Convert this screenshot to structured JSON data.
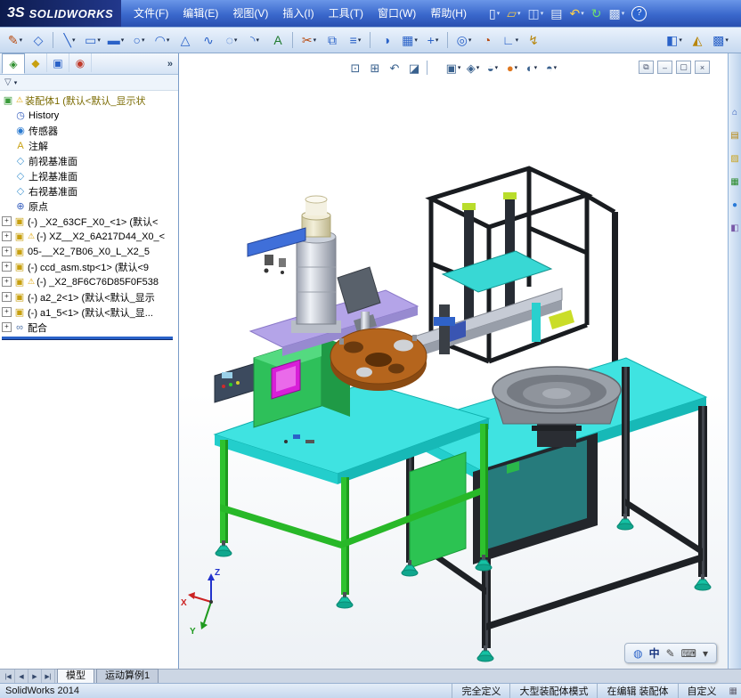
{
  "ui": {
    "caret": "▾",
    "warn_glyph": "⚠",
    "plus_glyph": "+",
    "chevrons": "»"
  },
  "titlebar": {
    "logo_mark": "3S",
    "logo_text": "SOLIDWORKS",
    "menus": [
      {
        "name": "menu-file",
        "label": "文件(F)"
      },
      {
        "name": "menu-edit",
        "label": "编辑(E)"
      },
      {
        "name": "menu-view",
        "label": "视图(V)"
      },
      {
        "name": "menu-insert",
        "label": "插入(I)"
      },
      {
        "name": "menu-tools",
        "label": "工具(T)"
      },
      {
        "name": "menu-window",
        "label": "窗口(W)"
      },
      {
        "name": "menu-help",
        "label": "帮助(H)"
      }
    ],
    "tools": [
      {
        "name": "new-button",
        "glyph": "▯",
        "color": "#f4f8ff",
        "caret": true
      },
      {
        "name": "open-button",
        "glyph": "▱",
        "color": "#f2c84b",
        "caret": true
      },
      {
        "name": "save-button",
        "glyph": "◫",
        "color": "#cfe0ff",
        "caret": true
      },
      {
        "name": "print-button",
        "glyph": "▤",
        "color": "#e4ecf8"
      },
      {
        "name": "undo-button",
        "glyph": "↶",
        "color": "#ffd24a",
        "caret": true
      },
      {
        "name": "rebuild-button",
        "glyph": "↻",
        "color": "#6fe06f"
      },
      {
        "name": "options-button",
        "glyph": "▩",
        "color": "#dde6f4",
        "caret": true
      },
      {
        "name": "help-button",
        "glyph": "?",
        "color": "#ffffff"
      }
    ]
  },
  "toolbar2": {
    "buttons": [
      {
        "name": "sketch-button",
        "glyph": "✎",
        "color": "#b84a10",
        "caret": true
      },
      {
        "name": "smart-dimension-button",
        "glyph": "◇",
        "color": "#2a62c8"
      },
      {
        "name": "separator"
      },
      {
        "name": "line-tool-button",
        "glyph": "╲",
        "color": "#2a62c8",
        "caret": true
      },
      {
        "name": "rectangle-tool-button",
        "glyph": "▭",
        "color": "#2a62c8",
        "caret": true
      },
      {
        "name": "slot-tool-button",
        "glyph": "▬",
        "color": "#2a62c8",
        "caret": true
      },
      {
        "name": "circle-tool-button",
        "glyph": "○",
        "color": "#2a62c8",
        "caret": true
      },
      {
        "name": "arc-tool-button",
        "glyph": "◠",
        "color": "#2a62c8",
        "caret": true
      },
      {
        "name": "polygon-tool-button",
        "glyph": "△",
        "color": "#2a62c8"
      },
      {
        "name": "spline-tool-button",
        "glyph": "∿",
        "color": "#2a62c8"
      },
      {
        "name": "ellipse-tool-button",
        "glyph": "◌",
        "color": "#2a62c8",
        "caret": true
      },
      {
        "name": "fillet-tool-button",
        "glyph": "◝",
        "color": "#2a62c8",
        "caret": true
      },
      {
        "name": "text-tool-button",
        "glyph": "A",
        "color": "#1f7a2f"
      },
      {
        "name": "separator"
      },
      {
        "name": "trim-entities-button",
        "glyph": "✂",
        "color": "#b84a10",
        "caret": true
      },
      {
        "name": "convert-entities-button",
        "glyph": "⧉",
        "color": "#2a62c8"
      },
      {
        "name": "offset-entities-button",
        "glyph": "≡",
        "color": "#2a62c8",
        "caret": true
      },
      {
        "name": "separator"
      },
      {
        "name": "mirror-entities-button",
        "glyph": "◑",
        "color": "#2a62c8"
      },
      {
        "name": "linear-pattern-button",
        "glyph": "▦",
        "color": "#2a62c8",
        "caret": true
      },
      {
        "name": "move-entities-button",
        "glyph": "+",
        "color": "#2a62c8",
        "caret": true
      },
      {
        "name": "separator"
      },
      {
        "name": "display-relations-button",
        "glyph": "◎",
        "color": "#2a62c8",
        "caret": true
      },
      {
        "name": "repair-sketch-button",
        "glyph": "◔",
        "color": "#b84a10"
      },
      {
        "name": "quick-snaps-button",
        "glyph": "∟",
        "color": "#2a62c8",
        "caret": true
      },
      {
        "name": "rapid-sketch-button",
        "glyph": "↯",
        "color": "#b8860b"
      }
    ],
    "right_buttons": [
      {
        "name": "selection-filter-button",
        "glyph": "◧",
        "color": "#2a62c8",
        "caret": true
      },
      {
        "name": "instant3d-button",
        "glyph": "◭",
        "color": "#b8860b"
      },
      {
        "name": "view-settings-dropdown-button",
        "glyph": "▩",
        "color": "#2a62c8",
        "caret": true
      }
    ]
  },
  "panel": {
    "tabs": [
      {
        "name": "featuremanager-tab",
        "glyph": "◈",
        "color": "#2f8f2f"
      },
      {
        "name": "propertymanager-tab",
        "glyph": "◆",
        "color": "#c8a010"
      },
      {
        "name": "configurationmanager-tab",
        "glyph": "▣",
        "color": "#2a62c8"
      },
      {
        "name": "displaymanager-tab",
        "glyph": "◉",
        "color": "#c03a2a"
      }
    ],
    "filter_glyph": "▽",
    "tree_items": [
      {
        "name": "tree-root-assembly",
        "pad": "2px",
        "icon": "▣",
        "iconName": "assembly-icon",
        "iconColor": "#3a9b3a",
        "warn": true,
        "label": "装配体1 (默认<默认_显示状",
        "labelColor": "#7a6a00"
      },
      {
        "name": "tree-item-history",
        "pad": "16px",
        "icon": "◷",
        "iconName": "history-icon",
        "iconColor": "#3a62c0",
        "label": "History"
      },
      {
        "name": "tree-item-sensors",
        "pad": "16px",
        "icon": "◉",
        "iconName": "sensors-icon",
        "iconColor": "#2a7ad0",
        "label": "传感器"
      },
      {
        "name": "tree-item-annotations",
        "pad": "16px",
        "icon": "A",
        "iconName": "annotations-icon",
        "iconColor": "#c8a010",
        "label": "注解"
      },
      {
        "name": "tree-item-front-plane",
        "pad": "16px",
        "icon": "◇",
        "iconName": "plane-icon",
        "iconColor": "#4a9ad4",
        "label": "前视基准面"
      },
      {
        "name": "tree-item-top-plane",
        "pad": "16px",
        "icon": "◇",
        "iconName": "plane-icon",
        "iconColor": "#4a9ad4",
        "label": "上视基准面"
      },
      {
        "name": "tree-item-right-plane",
        "pad": "16px",
        "icon": "◇",
        "iconName": "plane-icon",
        "iconColor": "#4a9ad4",
        "label": "右视基准面"
      },
      {
        "name": "tree-item-origin",
        "pad": "16px",
        "icon": "⊕",
        "iconName": "origin-icon",
        "iconColor": "#3a62c0",
        "label": "原点"
      },
      {
        "name": "tree-item-component-1",
        "pad": "2px",
        "plus": true,
        "icon": "▣",
        "iconName": "component-icon",
        "iconColor": "#c8a010",
        "label": "(-) _X2_63CF_X0_<1> (默认<"
      },
      {
        "name": "tree-item-component-2",
        "pad": "2px",
        "plus": true,
        "icon": "▣",
        "iconName": "component-icon",
        "iconColor": "#c8a010",
        "warn": true,
        "label": "(-) XZ__X2_6A217D44_X0_<"
      },
      {
        "name": "tree-item-component-3",
        "pad": "2px",
        "plus": true,
        "icon": "▣",
        "iconName": "component-icon",
        "iconColor": "#c8a010",
        "label": "05-__X2_7B06_X0_L_X2_5"
      },
      {
        "name": "tree-item-component-4",
        "pad": "2px",
        "plus": true,
        "icon": "▣",
        "iconName": "component-icon",
        "iconColor": "#c8a010",
        "label": "(-) ccd_asm.stp<1> (默认<9"
      },
      {
        "name": "tree-item-component-5",
        "pad": "2px",
        "plus": true,
        "icon": "▣",
        "iconName": "component-icon",
        "iconColor": "#c8a010",
        "warn": true,
        "label": "(-) _X2_8F6C76D85F0F538"
      },
      {
        "name": "tree-item-component-6",
        "pad": "2px",
        "plus": true,
        "icon": "▣",
        "iconName": "component-icon",
        "iconColor": "#c8a010",
        "label": "(-) a2_2<1> (默认<默认_显示"
      },
      {
        "name": "tree-item-component-7",
        "pad": "2px",
        "plus": true,
        "icon": "▣",
        "iconName": "component-icon",
        "iconColor": "#c8a010",
        "label": "(-) a1_5<1> (默认<默认_显..."
      },
      {
        "name": "tree-item-mates",
        "pad": "2px",
        "plus": true,
        "icon": "∞",
        "iconName": "mates-icon",
        "iconColor": "#5577aa",
        "label": "配合"
      }
    ]
  },
  "viewport": {
    "hud": [
      {
        "name": "zoom-fit-button",
        "glyph": "⊡"
      },
      {
        "name": "zoom-area-button",
        "glyph": "⊞"
      },
      {
        "name": "previous-view-button",
        "glyph": "↶"
      },
      {
        "name": "section-view-button",
        "glyph": "◪"
      },
      {
        "name": "separator"
      },
      {
        "name": "view-orientation-button",
        "glyph": "▣",
        "caret": true
      },
      {
        "name": "display-style-button",
        "glyph": "◈",
        "caret": true
      },
      {
        "name": "hide-show-items-button",
        "glyph": "◒",
        "caret": true
      },
      {
        "name": "edit-appearance-button",
        "glyph": "●",
        "color": "#e07820",
        "caret": true
      },
      {
        "name": "apply-scene-button",
        "glyph": "◐",
        "caret": true
      },
      {
        "name": "visualization-button",
        "glyph": "◓",
        "caret": true
      }
    ],
    "doc_controls": [
      {
        "name": "restore-window-button",
        "glyph": "⧉"
      },
      {
        "name": "minimize-window-button",
        "glyph": "–"
      },
      {
        "name": "maximize-window-button",
        "glyph": "▢"
      },
      {
        "name": "close-window-button",
        "glyph": "×"
      }
    ],
    "triad": {
      "x_label": "X",
      "y_label": "Y",
      "z_label": "Z"
    },
    "langbar": [
      {
        "name": "ime-icon",
        "glyph": "◍",
        "color": "#2a62c8"
      },
      {
        "name": "ime-language-indicator",
        "glyph": "中",
        "color": "#16337f"
      },
      {
        "name": "ime-pen-icon",
        "glyph": "✎",
        "color": "#444444"
      },
      {
        "name": "ime-keyboard-icon",
        "glyph": "⌨",
        "color": "#444444"
      },
      {
        "name": "ime-options-caret",
        "glyph": "▾",
        "color": "#444444"
      }
    ]
  },
  "taskpane": {
    "icons": [
      {
        "name": "resources-tab-icon",
        "glyph": "⌂",
        "color": "#2a55b8"
      },
      {
        "name": "design-library-tab-icon",
        "glyph": "▤",
        "color": "#b8860b"
      },
      {
        "name": "file-explorer-tab-icon",
        "glyph": "▨",
        "color": "#caa21a"
      },
      {
        "name": "view-palette-tab-icon",
        "glyph": "▦",
        "color": "#2a8a2a"
      },
      {
        "name": "appearances-tab-icon",
        "glyph": "●",
        "color": "#2a7ad8"
      },
      {
        "name": "custom-properties-tab-icon",
        "glyph": "◧",
        "color": "#7a5aa8"
      }
    ]
  },
  "tabsrow": {
    "nav": [
      {
        "name": "scroll-first-button",
        "glyph": "|◀"
      },
      {
        "name": "scroll-prev-button",
        "glyph": "◀"
      },
      {
        "name": "scroll-next-button",
        "glyph": "▶"
      },
      {
        "name": "scroll-last-button",
        "glyph": "▶|"
      }
    ],
    "tabs": [
      {
        "name": "model-tab",
        "label": "模型",
        "bg": "#f6f8fb"
      },
      {
        "name": "motion-study-tab",
        "label": "运动算例1",
        "bg": "#c4cedd"
      }
    ]
  },
  "statusbar": {
    "left": "SolidWorks 2014",
    "grip_glyph": "▦",
    "segments": [
      {
        "name": "status-fully-defined",
        "label": "完全定义"
      },
      {
        "name": "status-large-assembly-mode",
        "label": "大型装配体模式"
      },
      {
        "name": "status-editing-assembly",
        "label": "在编辑 装配体"
      },
      {
        "name": "status-custom",
        "label": "自定义"
      }
    ]
  }
}
